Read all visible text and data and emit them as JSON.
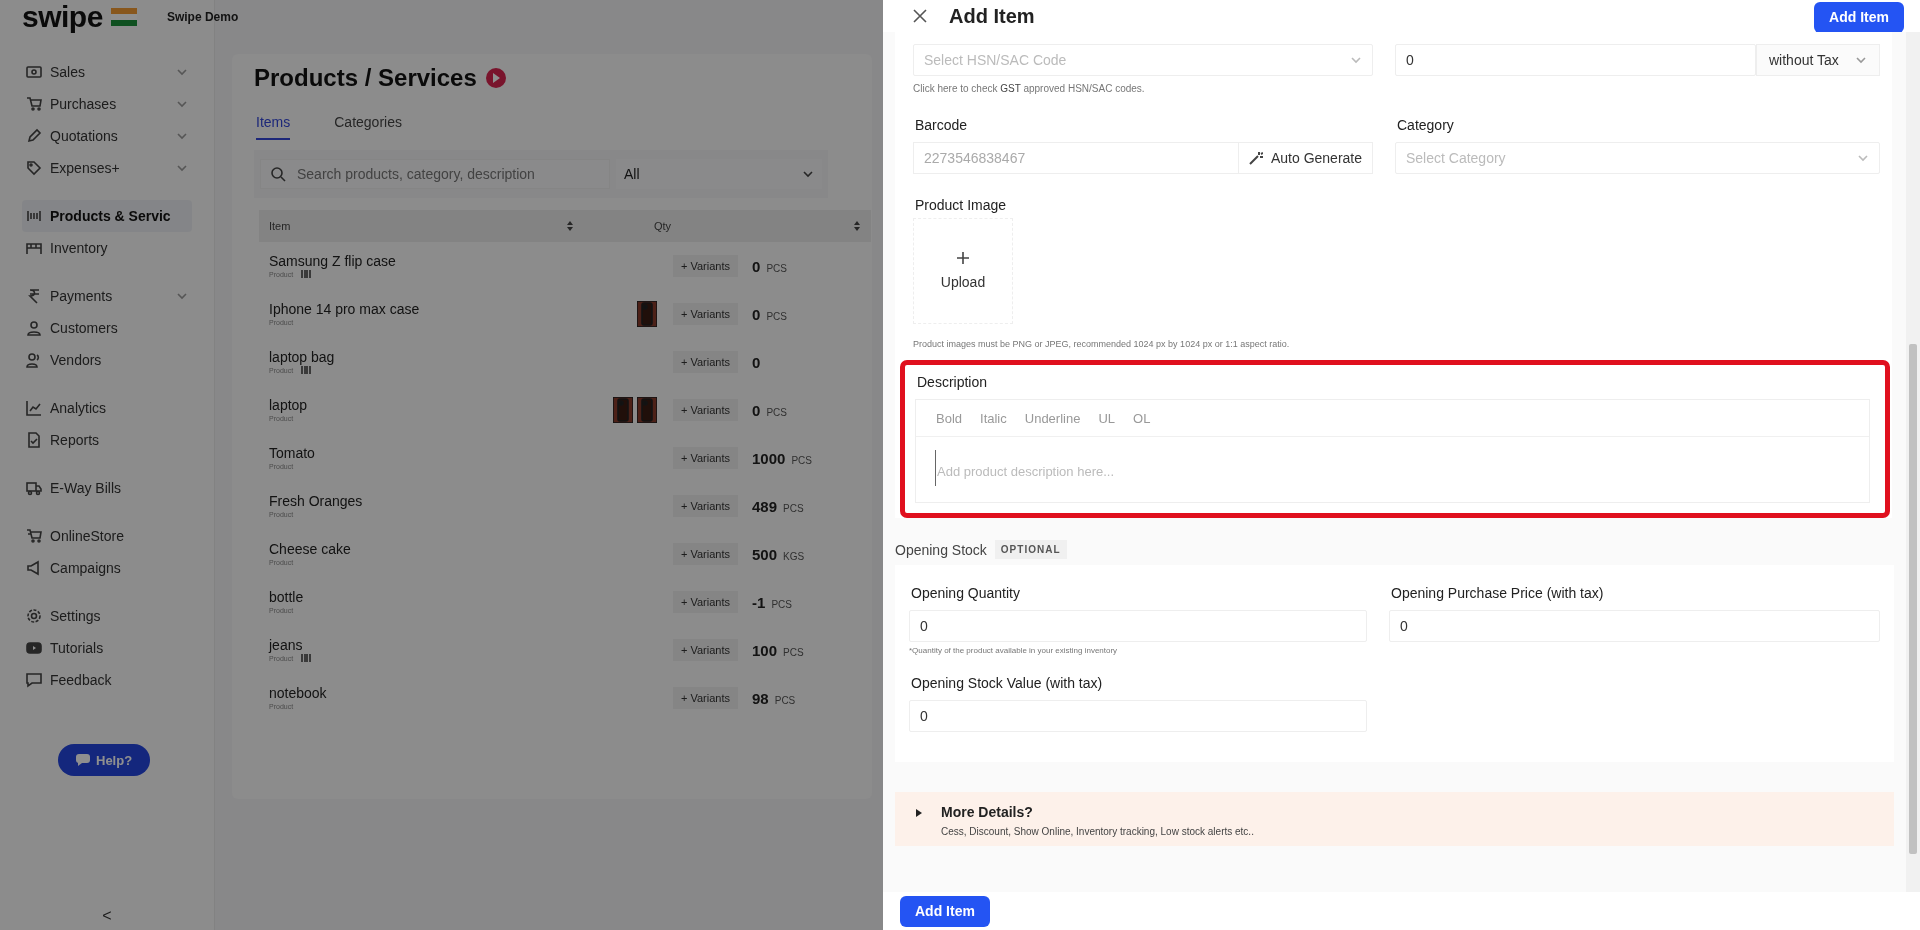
{
  "sidebar": {
    "brand": "swipe",
    "company": "Swipe Demo",
    "groups": [
      [
        {
          "label": "Sales",
          "has_menu": true,
          "selected": false
        },
        {
          "label": "Purchases",
          "has_menu": true,
          "selected": false
        },
        {
          "label": "Quotations",
          "has_menu": true,
          "selected": false
        },
        {
          "label": "Expenses+",
          "has_menu": true,
          "selected": false
        }
      ],
      [
        {
          "label": "Products & Servic",
          "has_menu": false,
          "selected": true
        },
        {
          "label": "Inventory",
          "has_menu": false,
          "selected": false
        }
      ],
      [
        {
          "label": "Payments",
          "has_menu": true,
          "selected": false
        },
        {
          "label": "Customers",
          "has_menu": false,
          "selected": false
        },
        {
          "label": "Vendors",
          "has_menu": false,
          "selected": false
        }
      ],
      [
        {
          "label": "Analytics",
          "has_menu": false,
          "selected": false
        },
        {
          "label": "Reports",
          "has_menu": false,
          "selected": false
        }
      ],
      [
        {
          "label": "E-Way Bills",
          "has_menu": false,
          "selected": false
        }
      ],
      [
        {
          "label": "OnlineStore",
          "has_menu": false,
          "selected": false
        },
        {
          "label": "Campaigns",
          "has_menu": false,
          "selected": false
        }
      ],
      [
        {
          "label": "Settings",
          "has_menu": false,
          "selected": false
        },
        {
          "label": "Tutorials",
          "has_menu": false,
          "selected": false
        },
        {
          "label": "Feedback",
          "has_menu": false,
          "selected": false
        }
      ]
    ],
    "help_button": "Help?",
    "collapse": "<"
  },
  "page": {
    "title": "Products / Services",
    "tabs": [
      {
        "label": "Items",
        "selected": true
      },
      {
        "label": "Categories",
        "selected": false
      }
    ],
    "search": {
      "placeholder": "Search products, category, description"
    },
    "filter": {
      "value": "All"
    },
    "table": {
      "columns": [
        "Item",
        "Qty"
      ],
      "rows": [
        {
          "name": "Samsung Z flip case",
          "type": "Product",
          "barcode": true,
          "thumbnails": [],
          "variants": "+ Variants",
          "qty": "0",
          "unit": "PCS"
        },
        {
          "name": "Iphone 14 pro max case",
          "type": "Product",
          "barcode": false,
          "variants": "+ Variants",
          "qty": "0",
          "unit": "PCS"
        },
        {
          "name": "laptop bag",
          "type": "Product",
          "barcode": true,
          "thumbnails": [],
          "variants": "+ Variants",
          "qty": "0"
        },
        {
          "name": "laptop",
          "type": "Product",
          "barcode": false,
          "variants": "+ Variants",
          "qty": "0",
          "unit": "PCS"
        },
        {
          "name": "Tomato",
          "type": "Product",
          "barcode": false,
          "thumbnails": [],
          "variants": "+ Variants",
          "qty": "1000",
          "unit": "PCS"
        },
        {
          "name": "Fresh Oranges",
          "type": "Product",
          "barcode": false,
          "thumbnails": [],
          "variants": "+ Variants",
          "qty": "489",
          "unit": "PCS"
        },
        {
          "name": "Cheese cake",
          "type": "Product",
          "barcode": false,
          "thumbnails": [],
          "variants": "+ Variants",
          "qty": "500",
          "unit": "KGS"
        },
        {
          "name": "bottle",
          "type": "Product",
          "barcode": false,
          "thumbnails": [],
          "variants": "+ Variants",
          "qty": "-1",
          "unit": "PCS"
        },
        {
          "name": "jeans",
          "type": "Product",
          "barcode": true,
          "thumbnails": [],
          "variants": "+ Variants",
          "qty": "100",
          "unit": "PCS"
        },
        {
          "name": "notebook",
          "type": "Product",
          "barcode": false,
          "thumbnails": [],
          "variants": "+ Variants",
          "qty": "98",
          "unit": "PCS"
        }
      ]
    }
  },
  "drawer": {
    "title": "Add Item",
    "header_button": "Add Item",
    "hsn": {
      "placeholder": "Select HSN/SAC Code",
      "hint": "Click here to check **GST** approved HSN/SAC codes."
    },
    "price": {
      "value": "0",
      "tax_mode": "without Tax"
    },
    "barcode": {
      "label": "Barcode",
      "placeholder": "2273546838467",
      "button": "Auto Generate"
    },
    "category": {
      "label": "Category",
      "placeholder": "Select Category"
    },
    "image": {
      "label": "Product Image",
      "upload": "Upload",
      "note": "Product images must be PNG or JPEG, recommended 1024 px by 1024 px or 1:1 aspect ratio."
    },
    "description": {
      "label": "Description",
      "toolbar": [
        "Bold",
        "Italic",
        "Underline",
        "UL",
        "OL"
      ],
      "placeholder": "Add product description here..."
    },
    "opening_stock": {
      "title": "Opening Stock",
      "badge": "OPTIONAL",
      "fields": [
        {
          "label": "Opening Quantity",
          "value": "0",
          "hint": "*Quantity of the product available in your existing inventory"
        },
        {
          "label": "Opening Purchase Price (with tax)",
          "value": "0"
        },
        {
          "label": "Opening Stock Value (with tax)",
          "value": "0"
        }
      ]
    },
    "more": {
      "title": "More Details?",
      "subtitle": "Cess, Discount, Show Online, Inventory tracking, Low stock alerts etc..",
      "expanded": false
    },
    "footer_button": "Add Item"
  }
}
